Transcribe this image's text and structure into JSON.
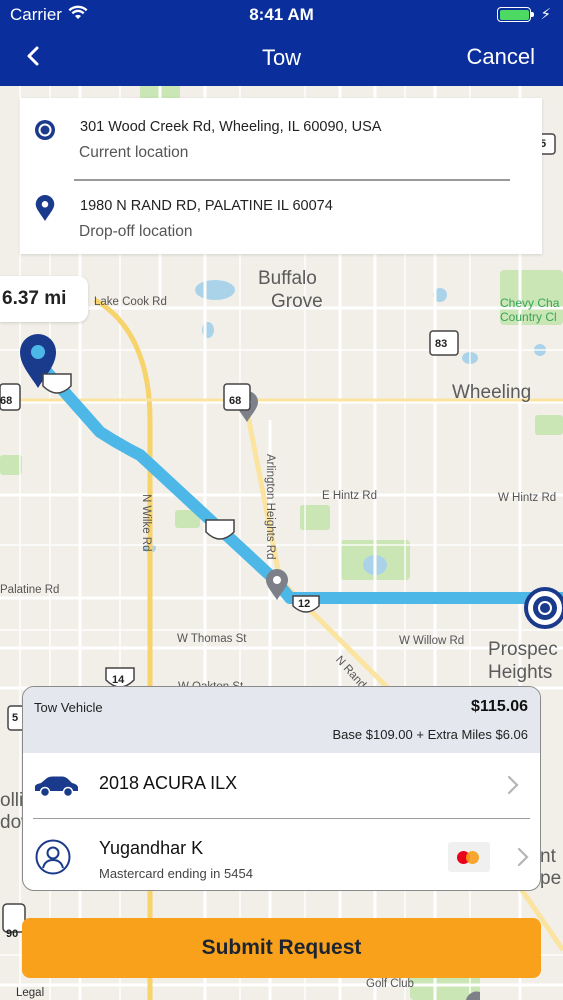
{
  "status_bar": {
    "carrier": "Carrier",
    "time": "8:41 AM",
    "charge": "⚡"
  },
  "nav": {
    "title": "Tow",
    "cancel_label": "Cancel"
  },
  "addresses": {
    "pickup": {
      "address": "301 Wood Creek Rd, Wheeling, IL 60090, USA",
      "label": "Current location"
    },
    "dropoff": {
      "address": "1980 N RAND RD, PALATINE IL 60074",
      "label": "Drop-off location"
    }
  },
  "distance": "6.37 mi",
  "map_labels": {
    "buffalo_grove_1": "Buffalo",
    "buffalo_grove_2": "Grove",
    "wheeling": "Wheeling",
    "prospect_1": "Prospec",
    "prospect_2": "Heights",
    "chevy_chase_1": "Chevy Cha",
    "chevy_chase_2": "Country Cl",
    "lake_cook_rd": "Lake Cook Rd",
    "e_hintz_rd": "E Hintz Rd",
    "w_hintz_rd": "W Hintz Rd",
    "palatine_rd": "Palatine Rd",
    "w_thomas_st": "W Thomas St",
    "w_willow_rd": "W Willow Rd",
    "n_rand_rd": "N Rand Rd",
    "n_wilke_rd": "N Wilke Rd",
    "arlington_heights_rd": "Arlington Heights Rd",
    "w_oakton_st": "W Oakton St",
    "golf_club": "Golf Club",
    "legal": "Legal",
    "shield_83": "83",
    "shield_68a": "68",
    "shield_68b": "68",
    "shield_12": "12",
    "shield_14": "14",
    "shield_5": "5",
    "shield_90": "90",
    "rolling_1": "olli",
    "rolling_2": "dow",
    "mount_1": "nt",
    "mount_2": "pe",
    "partial_5": "5"
  },
  "tow": {
    "label": "Tow Vehicle",
    "price": "$115.06",
    "breakdown": "Base $109.00 + Extra Miles $6.06",
    "vehicle": "2018 ACURA ILX",
    "payer_name": "Yugandhar K",
    "card": "Mastercard ending in 5454"
  },
  "submit_label": "Submit Request",
  "colors": {
    "nav_bg": "#0a2f9c",
    "route": "#4db8e8",
    "accent_button": "#f9a11b",
    "pin": "#1a3a8c"
  },
  "icons": {
    "back": "chevron-left-icon",
    "pickup": "target-icon",
    "dropoff": "location-pin-icon",
    "car": "car-icon",
    "user": "user-circle-icon",
    "mastercard": "mastercard-icon",
    "chevron": "chevron-right-icon"
  }
}
